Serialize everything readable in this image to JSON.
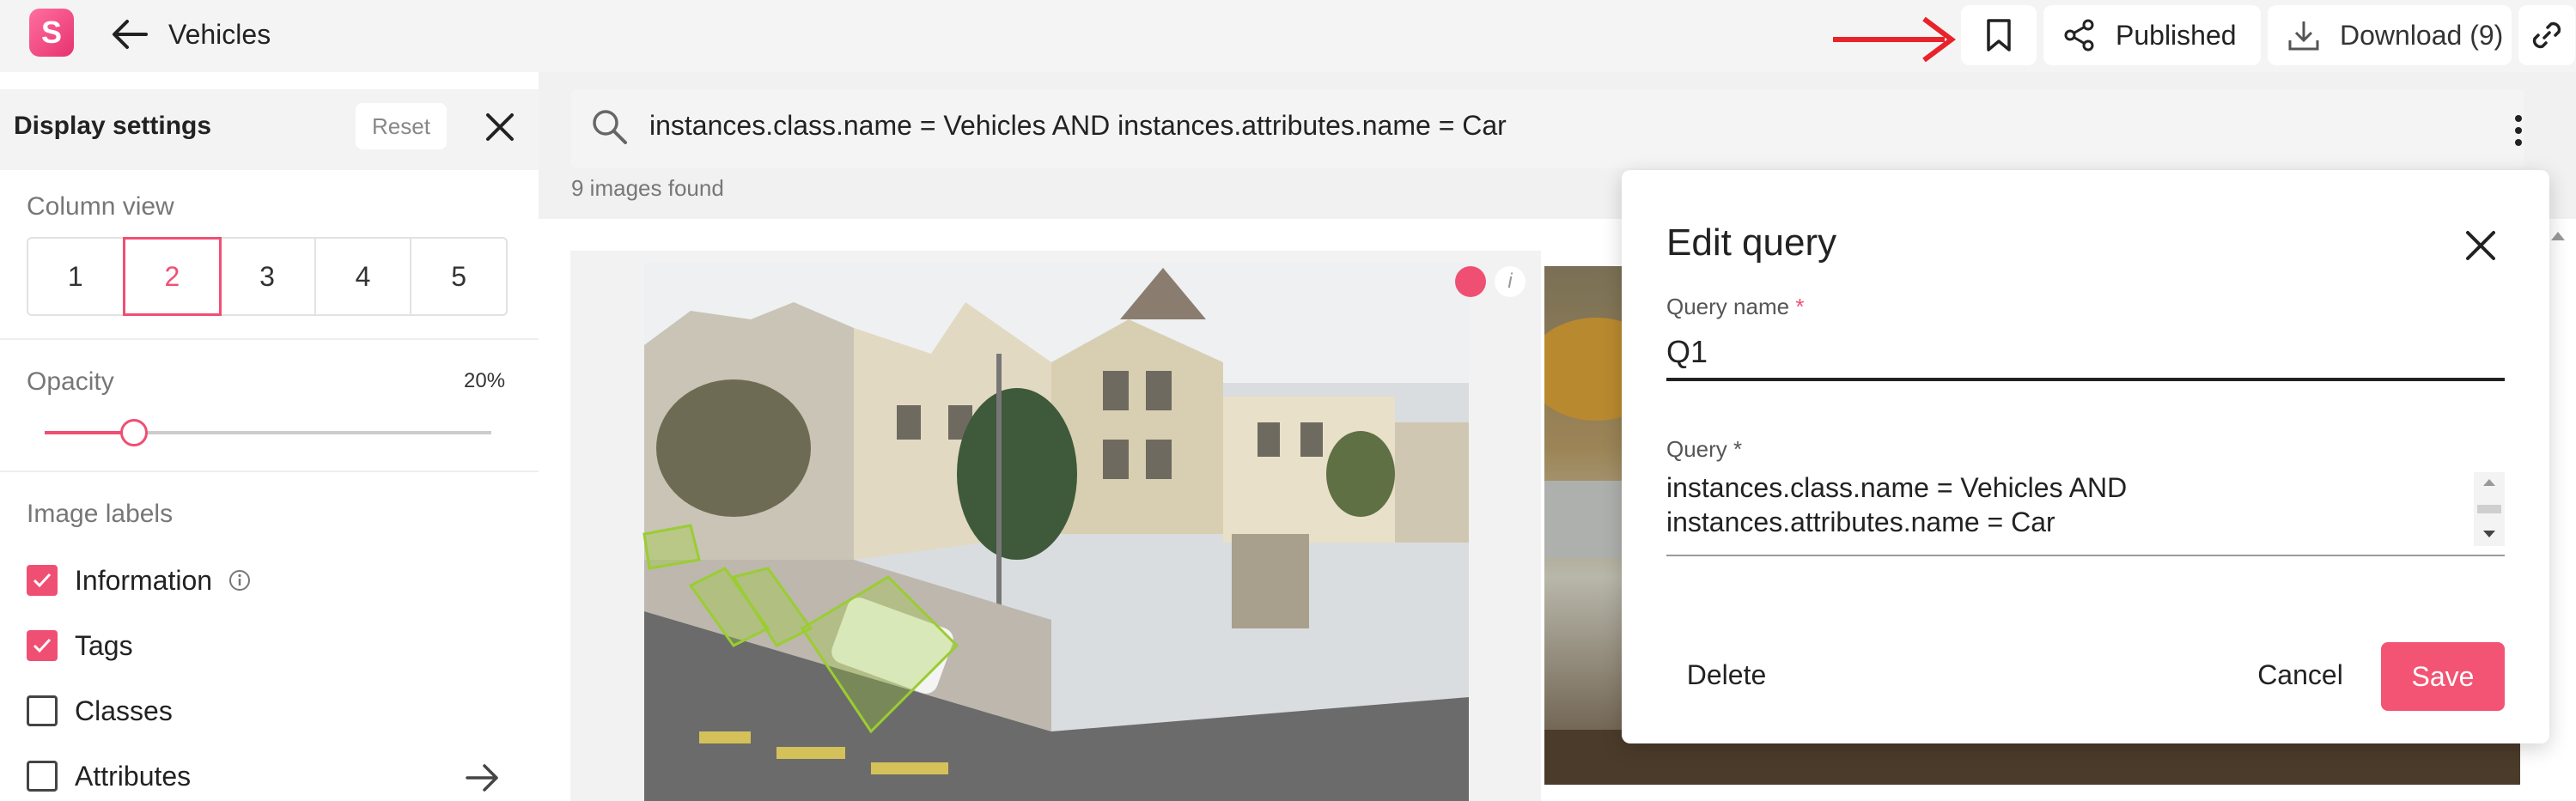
{
  "topbar": {
    "title": "Vehicles",
    "publish_label": "Published",
    "download_label": "Download (9)",
    "logo_letter": "S",
    "icons": [
      "back-arrow-icon",
      "bookmark-icon",
      "share-icon",
      "download-icon",
      "link-icon"
    ]
  },
  "sidebar": {
    "title": "Display settings",
    "reset_label": "Reset",
    "column_view": {
      "label": "Column view",
      "options": [
        "1",
        "2",
        "3",
        "4",
        "5"
      ],
      "selected": "2"
    },
    "opacity": {
      "label": "Opacity",
      "value_text": "20%",
      "value": 0.2
    },
    "image_labels": {
      "label": "Image labels",
      "items": [
        {
          "label": "Information",
          "checked": true
        },
        {
          "label": "Tags",
          "checked": true
        },
        {
          "label": "Classes",
          "checked": false
        },
        {
          "label": "Attributes",
          "checked": false
        }
      ]
    }
  },
  "main": {
    "search_query": "instances.class.name = Vehicles AND instances.attributes.name = Car",
    "results_text": "9 images found"
  },
  "modal": {
    "title": "Edit query",
    "query_name_label": "Query name",
    "query_name_value": "Q1",
    "query_label": "Query",
    "required_mark": "*",
    "query_value": "instances.class.name = Vehicles AND\ninstances.attributes.name = Car",
    "delete_label": "Delete",
    "cancel_label": "Cancel",
    "save_label": "Save"
  },
  "colors": {
    "accent": "#f04f74",
    "save_button": "#f35473",
    "annotation_box": "#9acd32",
    "pointer_arrow": "#e8232a"
  }
}
